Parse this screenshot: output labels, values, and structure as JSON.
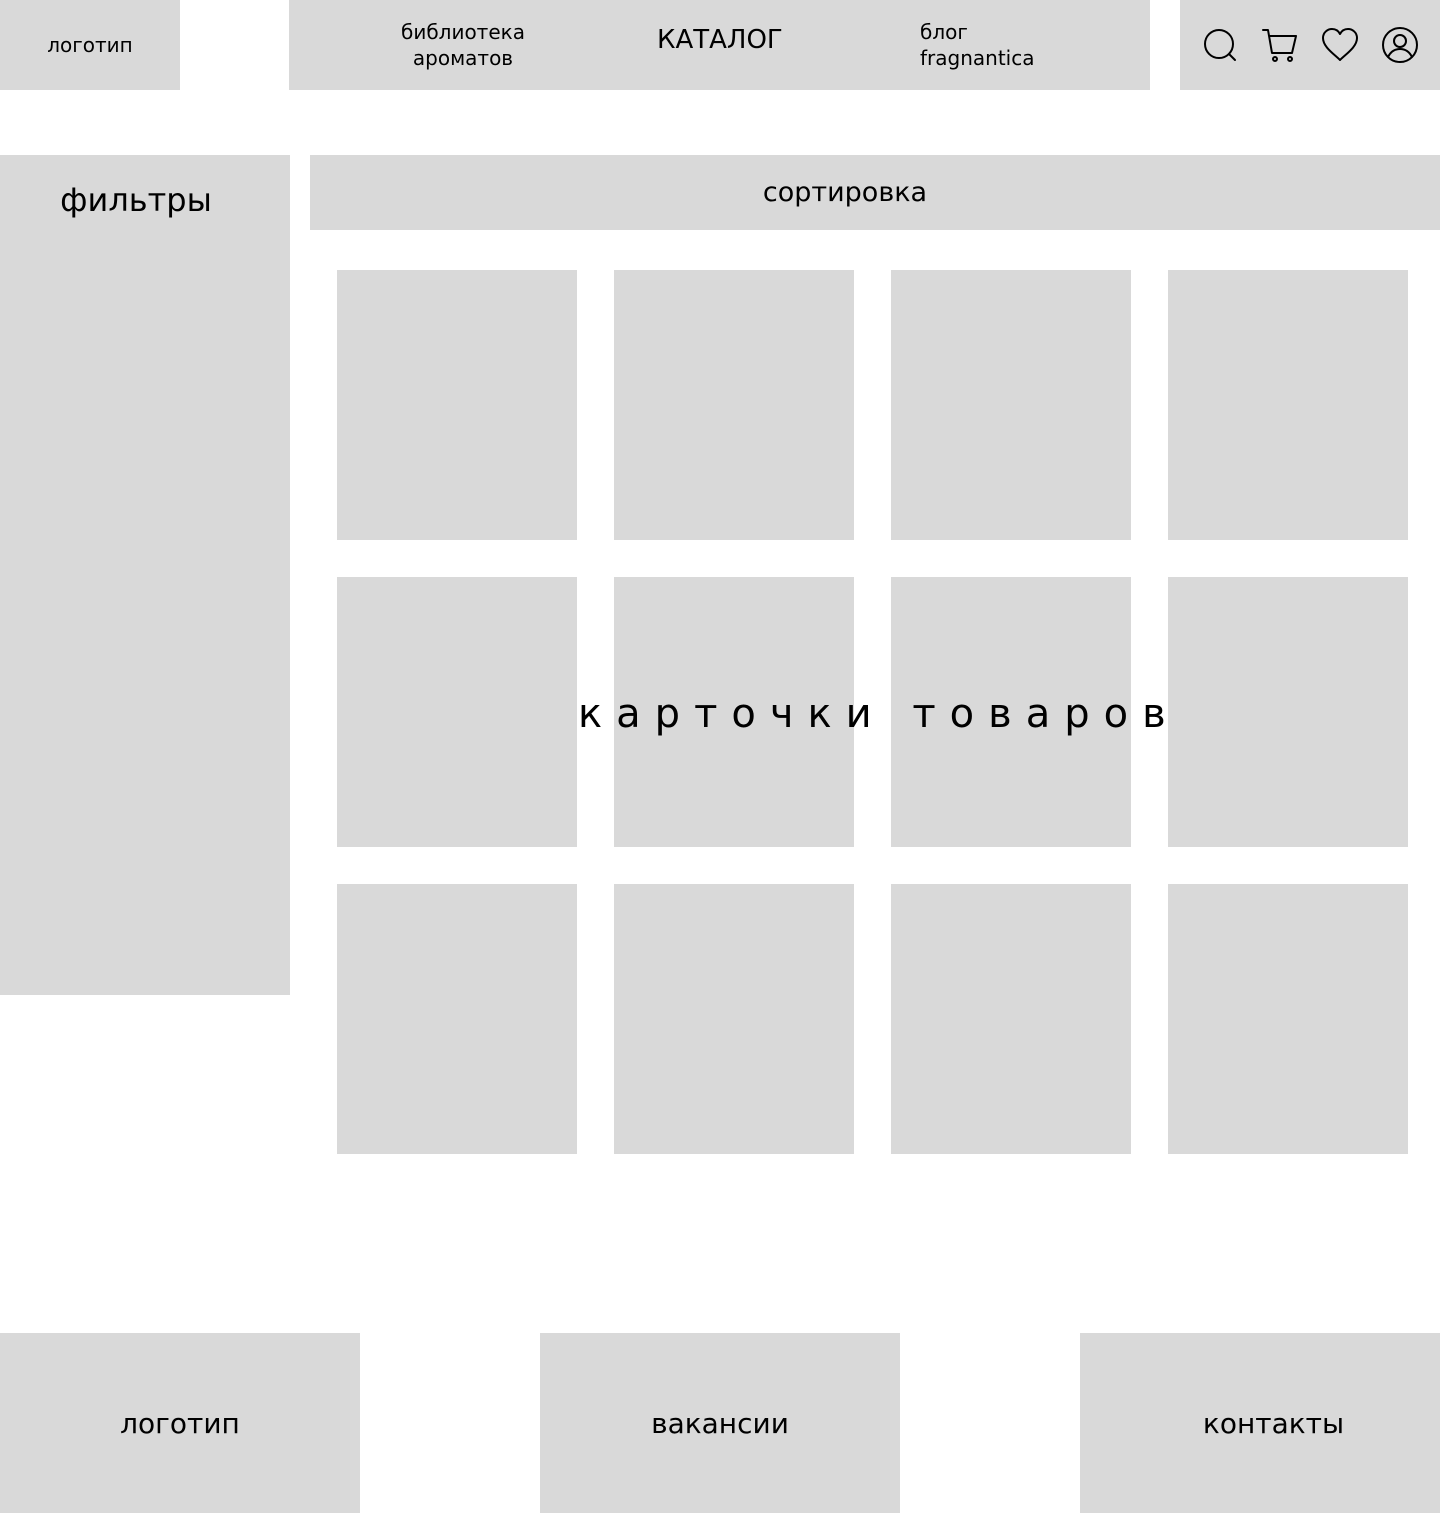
{
  "header": {
    "logo": "логотип",
    "nav": {
      "library_line1": "библиотека",
      "library_line2": "ароматов",
      "catalog": "КАТАЛОГ",
      "blog_line1": "блог",
      "blog_line2": "fragnantica"
    },
    "icons": [
      "search-icon",
      "cart-icon",
      "heart-icon",
      "user-icon"
    ]
  },
  "sidebar": {
    "title": "фильтры"
  },
  "sort": {
    "label": "сортировка"
  },
  "grid": {
    "label": "карточки товаров",
    "cards": 12
  },
  "footer": {
    "logo": "логотип",
    "vacancies": "вакансии",
    "contacts": "контакты"
  },
  "colors": {
    "block": "#d9d9d9",
    "background": "#ffffff",
    "text": "#000000"
  }
}
